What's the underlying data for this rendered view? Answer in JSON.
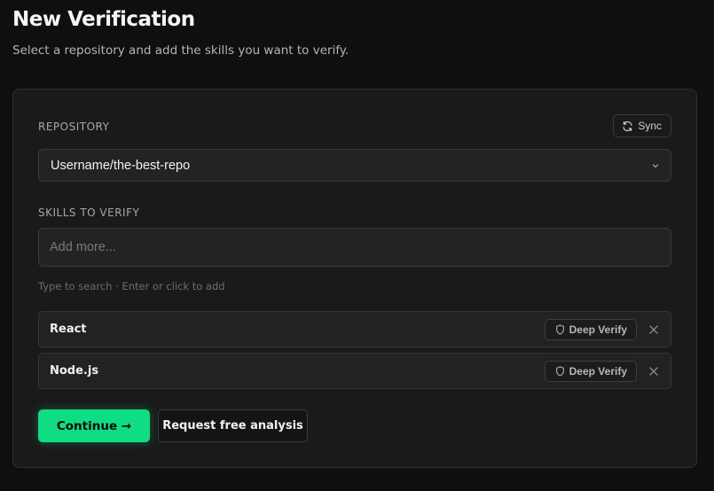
{
  "header": {
    "title": "New Verification",
    "subtitle": "Select a repository and add the skills you want to verify."
  },
  "repository": {
    "label": "REPOSITORY",
    "sync_label": "Sync",
    "selected": "Username/the-best-repo"
  },
  "skills": {
    "label": "SKILLS TO VERIFY",
    "placeholder": "Add more...",
    "hint": "Type to search · Enter or click to add",
    "items": [
      {
        "name": "React",
        "deep_verify_label": "Deep Verify"
      },
      {
        "name": "Node.js",
        "deep_verify_label": "Deep Verify"
      }
    ]
  },
  "actions": {
    "continue_label": "Continue →",
    "request_label": "Request free analysis"
  },
  "colors": {
    "accent": "#10dc83",
    "background": "#0f0f0f",
    "card": "#1a1a1a"
  },
  "icons": {
    "sync": "refresh-icon",
    "select": "chevron-down-icon",
    "deep_verify": "shield-icon",
    "remove": "close-icon"
  }
}
